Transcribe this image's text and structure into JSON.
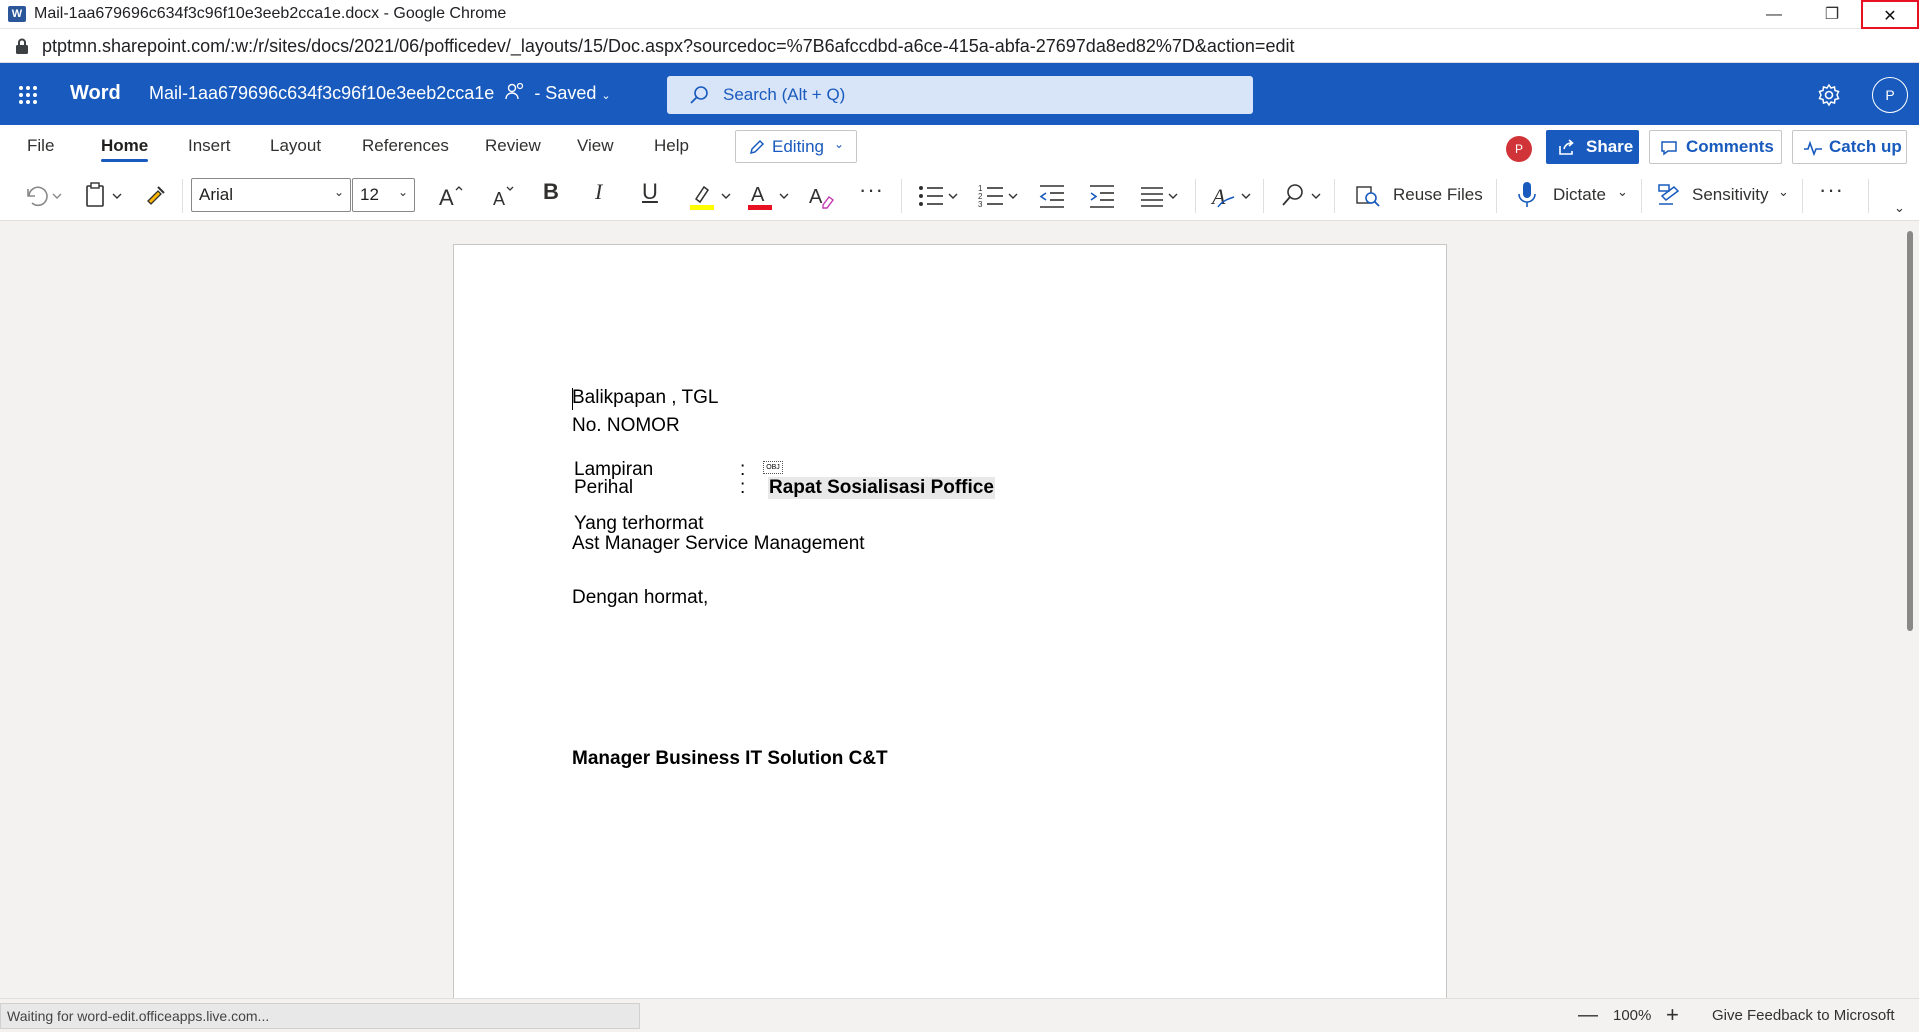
{
  "browser": {
    "window_title": "Mail-1aa679696c634f3c96f10e3eeb2cca1e.docx - Google Chrome",
    "app_icon_letter": "W",
    "url": "ptptmn.sharepoint.com/:w:/r/sites/docs/2021/06/pofficedev/_layouts/15/Doc.aspx?sourcedoc=%7B6afccdbd-a6ce-415a-abfa-27697da8ed82%7D&action=edit",
    "minimize_glyph": "—",
    "restore_glyph": "❐",
    "close_glyph": "✕"
  },
  "app": {
    "brand": "Word",
    "doc_name": "Mail-1aa679696c634f3c96f10e3eeb2cca1e",
    "saved_status": "- Saved",
    "search_placeholder": "Search (Alt + Q)",
    "avatar_initial": "P",
    "brand_color": "#185abd"
  },
  "ribbon": {
    "tabs": [
      "File",
      "Home",
      "Insert",
      "Layout",
      "References",
      "Review",
      "View",
      "Help"
    ],
    "active_tab": "Home",
    "mode_label": "Editing",
    "presence_initial": "P",
    "share_label": "Share",
    "comments_label": "Comments",
    "catchup_label": "Catch up"
  },
  "toolbar": {
    "font_name": "Arial",
    "font_size": "12",
    "bold_glyph": "B",
    "italic_glyph": "I",
    "underline_glyph": "U",
    "more_glyph": "···",
    "reuse_files_label": "Reuse Files",
    "dictate_label": "Dictate",
    "sensitivity_label": "Sensitivity",
    "highlight_color": "#ffff00",
    "font_color": "#e81123"
  },
  "document": {
    "line_place_date": "Balikpapan ,  TGL",
    "line_number": "No.  NOMOR",
    "lampiran_label": "Lampiran",
    "lampiran_colon": ":",
    "lampiran_obj": "OBJ",
    "perihal_label": "Perihal",
    "perihal_colon": ":",
    "perihal_value": "Rapat Sosialisasi Poffice",
    "recipient_line1": "Yang terhormat",
    "recipient_line2": "Ast Manager Service Management",
    "greeting": "Dengan hormat,",
    "signature": "Manager Business IT Solution C&T"
  },
  "status": {
    "loading_text": "Waiting for word-edit.officeapps.live.com...",
    "zoom_minus": "—",
    "zoom": "100%",
    "zoom_plus": "+",
    "feedback": "Give Feedback to Microsoft"
  }
}
